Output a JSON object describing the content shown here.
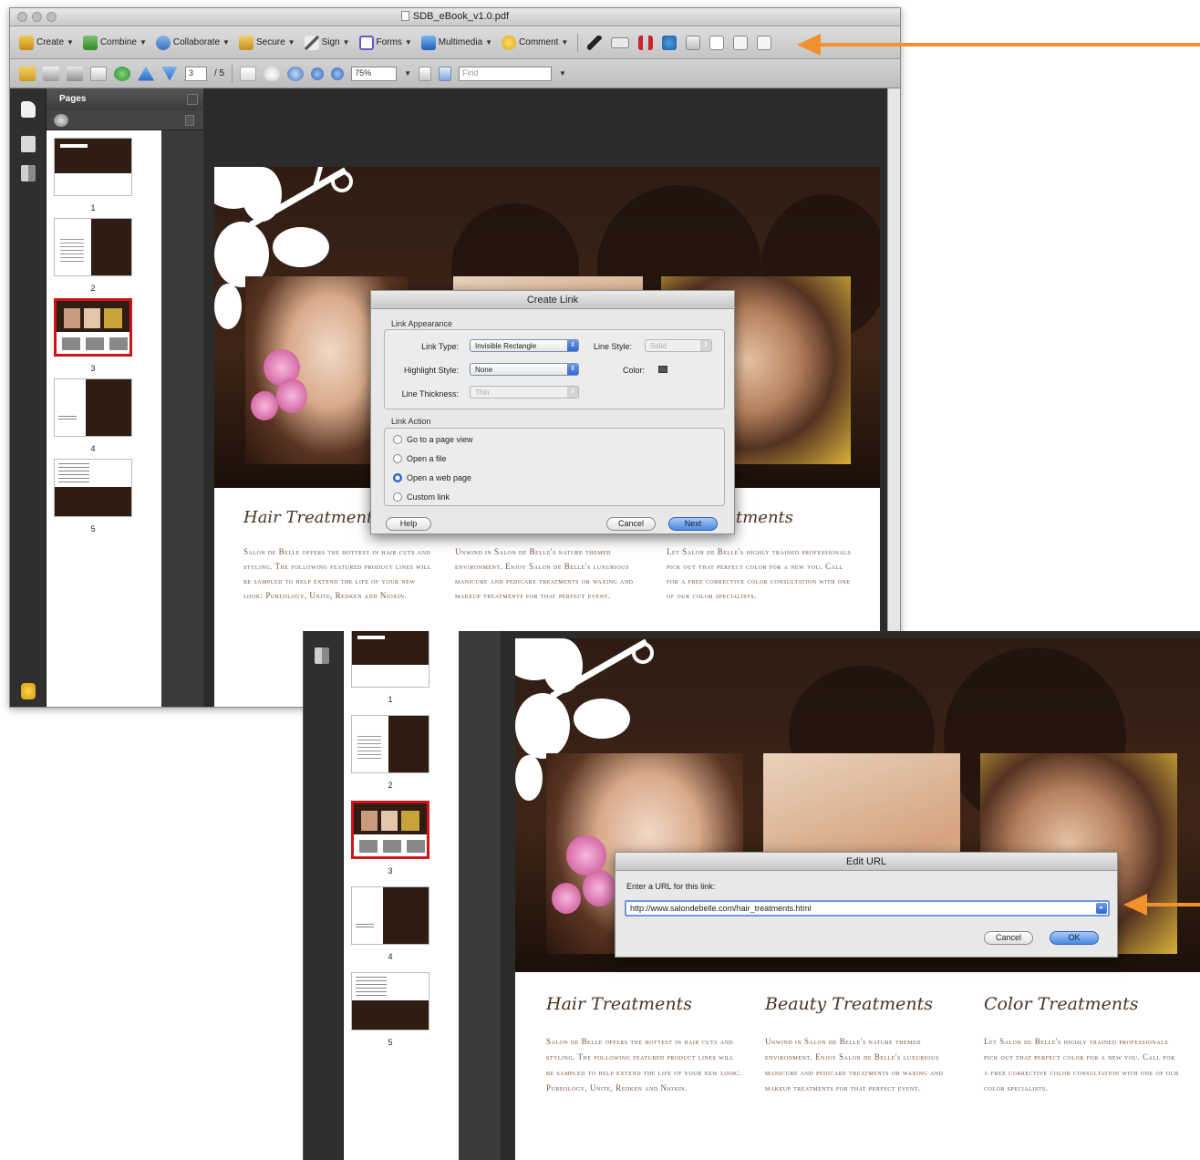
{
  "window": {
    "title": "SDB_eBook_v1.0.pdf"
  },
  "toolbar": {
    "items": [
      {
        "label": "Create",
        "icon": "create-pdf-icon"
      },
      {
        "label": "Combine",
        "icon": "combine-icon"
      },
      {
        "label": "Collaborate",
        "icon": "collaborate-icon"
      },
      {
        "label": "Secure",
        "icon": "lock-icon"
      },
      {
        "label": "Sign",
        "icon": "pen-icon"
      },
      {
        "label": "Forms",
        "icon": "forms-icon"
      },
      {
        "label": "Multimedia",
        "icon": "multimedia-icon"
      },
      {
        "label": "Comment",
        "icon": "comment-icon"
      }
    ]
  },
  "nav": {
    "page_current": "3",
    "page_total": "/ 5",
    "zoom": "75%",
    "find_placeholder": "Find"
  },
  "pages_panel": {
    "title": "Pages",
    "thumbs": [
      {
        "num": "1"
      },
      {
        "num": "2"
      },
      {
        "num": "3"
      },
      {
        "num": "4"
      },
      {
        "num": "5"
      }
    ]
  },
  "document": {
    "columns": [
      {
        "title": "Hair Treatments",
        "body": "Salon de Belle offers the hottest in hair cuts and styling. The following featured product lines will be sampled to help extend the life of your new look: Pureology, Unite, Redken and Nioxin."
      },
      {
        "title": "Beauty Treatments",
        "body": "Unwind in Salon de Belle's nature themed environment. Enjoy Salon de Belle's luxurious manicure and pedicare treatments or waxing and makeup treatments for that perfect event."
      },
      {
        "title": "Color Treatments",
        "body": "Let Salon de Belle's highly trained professionals pick out that perfect color for a new you. Call for a free corrective color consultation with one of our color specialists."
      }
    ],
    "col3_title_partial": "tments"
  },
  "create_link_dialog": {
    "title": "Create Link",
    "appearance_label": "Link Appearance",
    "link_type_label": "Link Type:",
    "link_type_value": "Invisible Rectangle",
    "line_style_label": "Line Style:",
    "line_style_value": "Solid",
    "highlight_label": "Highlight Style:",
    "highlight_value": "None",
    "color_label": "Color:",
    "thickness_label": "Line Thickness:",
    "thickness_value": "Thin",
    "action_label": "Link Action",
    "actions": [
      {
        "label": "Go to a page view",
        "selected": false
      },
      {
        "label": "Open a file",
        "selected": false
      },
      {
        "label": "Open a web page",
        "selected": true
      },
      {
        "label": "Custom link",
        "selected": false
      }
    ],
    "help_label": "Help",
    "cancel_label": "Cancel",
    "next_label": "Next"
  },
  "edit_url_dialog": {
    "title": "Edit URL",
    "prompt": "Enter a URL for this link:",
    "url": "http://www.salondebelle.com/hair_treatments.html",
    "cancel_label": "Cancel",
    "ok_label": "OK"
  },
  "colors": {
    "arrow": "#f0912e",
    "selection_red": "#d0141a",
    "banner_brown": "#3f2517",
    "title_brown": "#4a3324",
    "body_brown": "#6e5546"
  }
}
